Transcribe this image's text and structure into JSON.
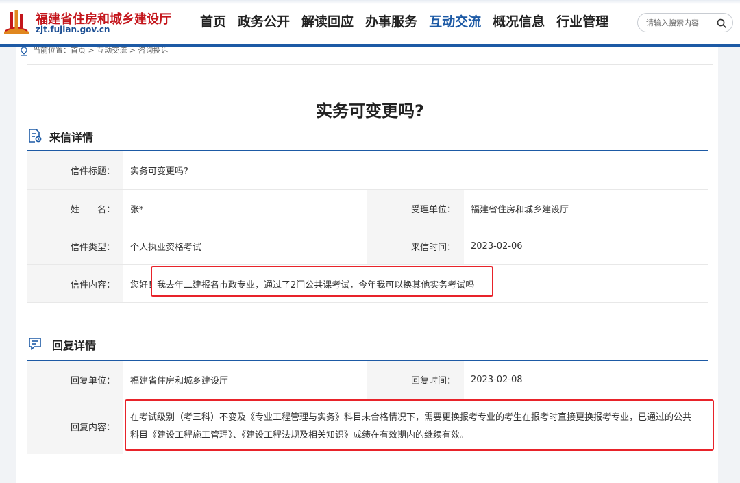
{
  "site": {
    "logo_title": "福建省住房和城乡建设厅",
    "logo_domain": "zjt.fujian.gov.cn"
  },
  "nav": {
    "items": [
      {
        "label": "首页"
      },
      {
        "label": "政务公开"
      },
      {
        "label": "解读回应"
      },
      {
        "label": "办事服务"
      },
      {
        "label": "互动交流",
        "active": true
      },
      {
        "label": "概况信息"
      },
      {
        "label": "行业管理"
      }
    ]
  },
  "search": {
    "placeholder": "请输入搜索内容"
  },
  "breadcrumb": {
    "text": "当前位置：首页 > 互动交流 > 咨询投诉"
  },
  "page": {
    "title": "实务可变更吗?"
  },
  "letter": {
    "section_title": "来信详情",
    "subject_label": "信件标题：",
    "subject_value": "实务可变更吗?",
    "name_label": "姓　　名：",
    "name_value": "张*",
    "unit_label": "受理单位：",
    "unit_value": "福建省住房和城乡建设厅",
    "type_label": "信件类型：",
    "type_value": "个人执业资格考试",
    "time_label": "来信时间：",
    "time_value": "2023-02-06",
    "content_label": "信件内容：",
    "content_value": "您好！我去年二建报名市政专业，通过了2门公共课考试，今年我可以换其他实务考试吗"
  },
  "reply": {
    "section_title": "回复详情",
    "unit_label": "回复单位：",
    "unit_value": "福建省住房和城乡建设厅",
    "time_label": "回复时间：",
    "time_value": "2023-02-08",
    "content_label": "回复内容：",
    "content_value": "在考试级别（考三科）不变及《专业工程管理与实务》科目未合格情况下，需要更换报考专业的考生在报考时直接更换报考专业，已通过的公共科目《建设工程施工管理》、《建设工程法规及相关知识》成绩在有效期内的继续有效。"
  },
  "colors": {
    "brand_blue": "#1d5aa5",
    "logo_red": "#c4161c",
    "highlight_red": "#e8232a"
  }
}
